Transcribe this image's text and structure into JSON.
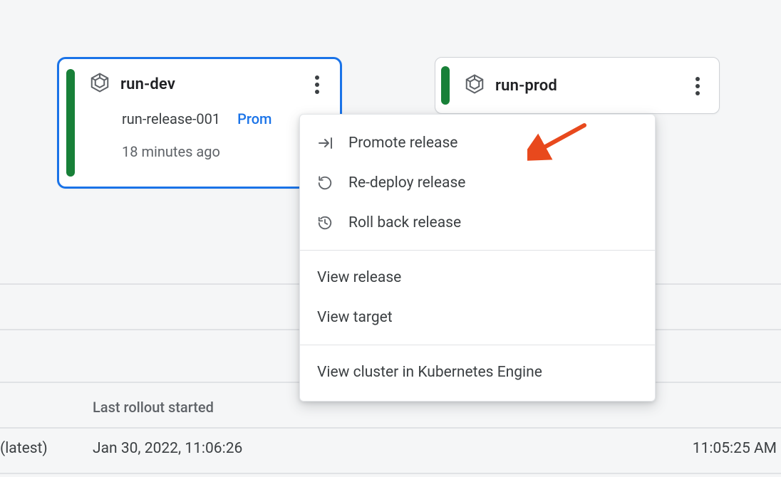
{
  "pipeline": {
    "dev": {
      "title": "run-dev",
      "release_name": "run-release-001",
      "promote_link_label": "Prom",
      "time_ago": "18 minutes ago"
    },
    "prod": {
      "title": "run-prod"
    }
  },
  "menu": {
    "promote": "Promote release",
    "redeploy": "Re-deploy release",
    "rollback": "Roll back release",
    "view_release": "View release",
    "view_target": "View target",
    "view_cluster": "View cluster in Kubernetes Engine"
  },
  "table": {
    "header_last_rollout": "Last rollout started",
    "latest_tag": "(latest)",
    "date_a": "Jan 30, 2022, 11:06:26",
    "date_b": "11:05:25 AM"
  },
  "colors": {
    "accent_blue": "#1a73e8",
    "status_green": "#188038",
    "annotation_orange": "#e8491d"
  },
  "icons": {
    "gke": "gke-hexagon-icon",
    "kebab": "more-vert-icon",
    "promote": "arrow-to-bar-right-icon",
    "redeploy": "refresh-icon",
    "rollback": "history-icon"
  }
}
